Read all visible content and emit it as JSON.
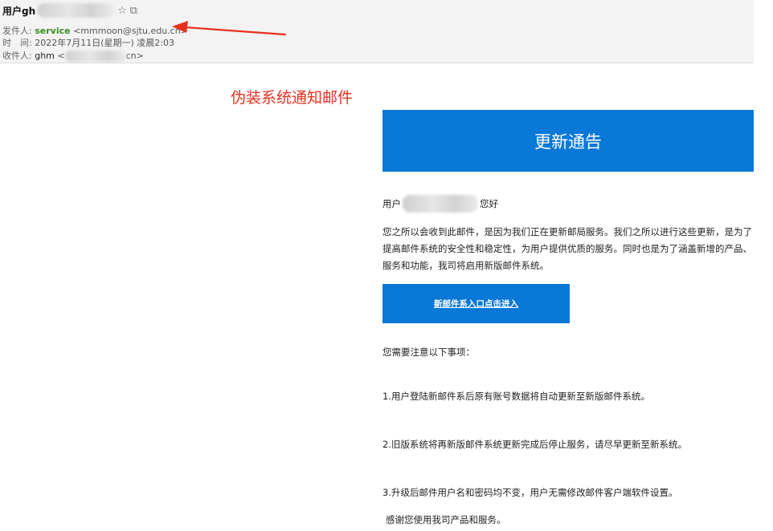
{
  "header": {
    "subject": "用户gh",
    "from_label": "发件人:",
    "sender_name": "service",
    "sender_email": "<mmmoon@sjtu.edu.cn>",
    "time_label": "时　间:",
    "time_value": "2022年7月11日(星期一) 凌晨2:03",
    "to_label": "收件人:",
    "to_name": "ghm",
    "to_email_prefix": "<",
    "to_email_suffix": "cn>",
    "star_icon": "☆",
    "popout_icon": "⧉"
  },
  "annotation": {
    "caption": "伪装系统通知邮件",
    "color": "#e8301e"
  },
  "email": {
    "banner_title": "更新通告",
    "greeting_prefix": "用户",
    "greeting_suffix": "您好",
    "body": "您之所以会收到此邮件，是因为我们正在更新邮局服务。我们之所以进行这些更新，是为了提高邮件系统的安全性和稳定性，为用户提供优质的服务。同时也是为了涵盖新增的产品、服务和功能，我司将启用新版邮件系统。",
    "cta_label": "新邮件系入口点击进入",
    "notes_title": "您需要注意以下事项：",
    "notes": [
      "1.用户登陆新邮件系后原有账号数据将自动更新至新版邮件系统。",
      "2.旧版系统将再新版邮件系统更新完成后停止服务，请尽早更新至新系统。",
      "3.升级后邮件用户名和密码均不变，用户无需修改邮件客户端软件设置。"
    ],
    "thanks": "感谢您使用我司产品和服务。",
    "accent_color": "#0a78d7"
  }
}
